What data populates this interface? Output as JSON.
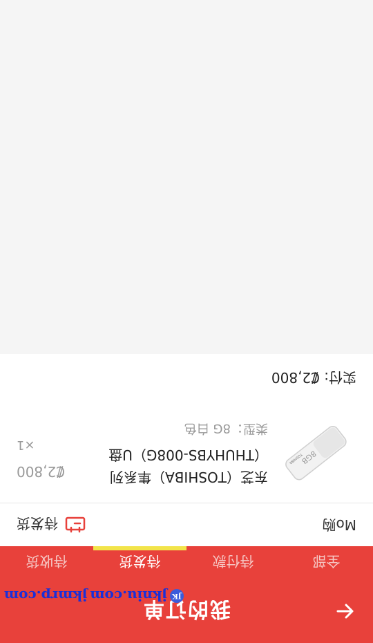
{
  "header": {
    "title": "我的订单",
    "back_icon": "arrow-left-icon",
    "watermark_logo": "JK",
    "watermark_site1": "jkniu.com",
    "watermark_site2": "jkmrp.com"
  },
  "tabs": [
    {
      "label": "全部"
    },
    {
      "label": "待付款"
    },
    {
      "label": "待发货",
      "active": true
    },
    {
      "label": "待收货"
    }
  ],
  "order": {
    "shop_name": "Mo购",
    "status": "待发货",
    "status_icon": "pending-ship-icon",
    "item": {
      "title": "东芝（TOSHIBA）隼系列（THUHYBS-008G）U盘",
      "spec": "类型：8G 白色",
      "price": "₡2,800",
      "qty": "×1",
      "image_label": "8GB",
      "image_brand": "TOSHIBA"
    },
    "paid_label": "实付:",
    "paid_amount": "₡2,800"
  },
  "colors": {
    "accent": "#e8413b",
    "tab_indicator": "#f2e44a",
    "background": "#f5f5f5"
  }
}
